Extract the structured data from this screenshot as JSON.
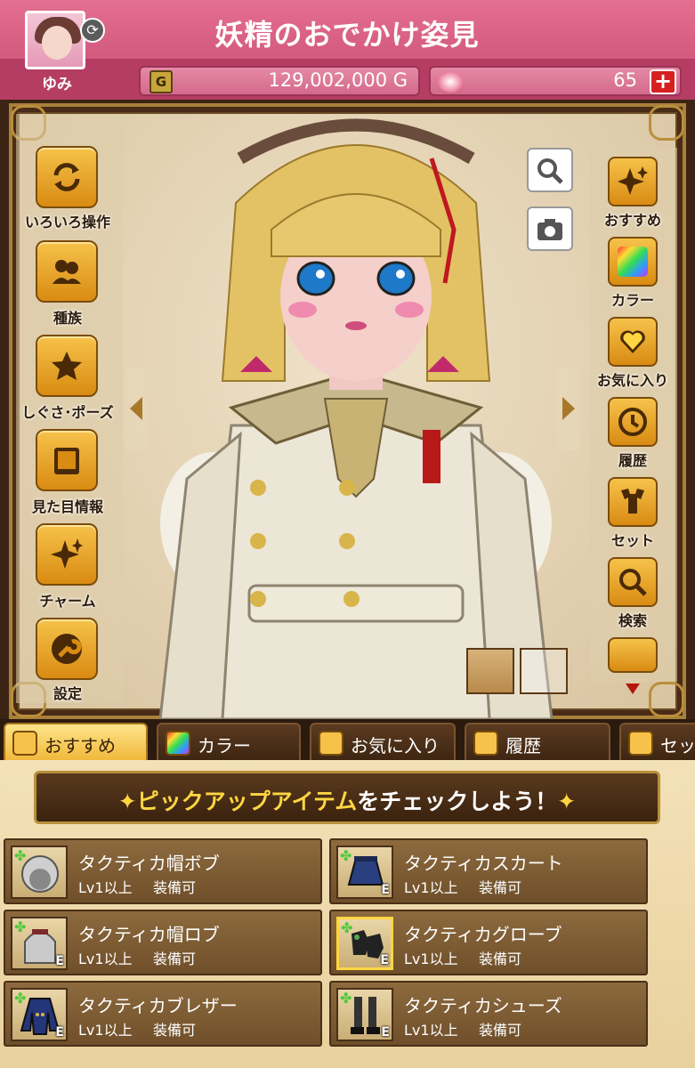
{
  "header": {
    "title": "妖精のおでかけ姿見",
    "user_name": "ゆみ",
    "gold": "129,002,000 G",
    "gold_icon_letter": "G",
    "gems": "65",
    "plus": "+"
  },
  "left_menu": [
    {
      "label": "いろいろ操作",
      "icon": "refresh-icon"
    },
    {
      "label": "種族",
      "icon": "species-icon"
    },
    {
      "label": "しぐさ･ポーズ",
      "icon": "star-icon"
    },
    {
      "label": "見た目情報",
      "icon": "book-icon"
    },
    {
      "label": "チャーム",
      "icon": "sparkle-icon"
    },
    {
      "label": "設定",
      "icon": "wrench-icon"
    }
  ],
  "right_menu": [
    {
      "label": "おすすめ",
      "icon": "sparkle-icon"
    },
    {
      "label": "カラー",
      "icon": "color-icon"
    },
    {
      "label": "お気に入り",
      "icon": "heart-icon"
    },
    {
      "label": "履歴",
      "icon": "history-icon"
    },
    {
      "label": "セット",
      "icon": "set-icon"
    },
    {
      "label": "検索",
      "icon": "search-icon"
    }
  ],
  "tabs": [
    {
      "label": "おすすめ",
      "active": true
    },
    {
      "label": "カラー",
      "active": false
    },
    {
      "label": "お気に入り",
      "active": false
    },
    {
      "label": "履歴",
      "active": false
    },
    {
      "label": "セット",
      "active": false
    }
  ],
  "banner": {
    "star": "✦",
    "highlight": "ピックアップアイテム",
    "rest": "をチェックしよう！"
  },
  "items": [
    {
      "name": "タクティカ帽ボブ",
      "level": "Lv1以上",
      "equip": "装備可",
      "e": ""
    },
    {
      "name": "タクティカスカート",
      "level": "Lv1以上",
      "equip": "装備可",
      "e": "E"
    },
    {
      "name": "タクティカ帽ロブ",
      "level": "Lv1以上",
      "equip": "装備可",
      "e": "E"
    },
    {
      "name": "タクティカグローブ",
      "level": "Lv1以上",
      "equip": "装備可",
      "e": "E"
    },
    {
      "name": "タクティカブレザー",
      "level": "Lv1以上",
      "equip": "装備可",
      "e": "E"
    },
    {
      "name": "タクティカシューズ",
      "level": "Lv1以上",
      "equip": "装備可",
      "e": "E"
    }
  ],
  "colors": {
    "header_pink": "#d65a80",
    "button_gold": "#f1b83b",
    "panel_brown": "#6f4f2a"
  }
}
